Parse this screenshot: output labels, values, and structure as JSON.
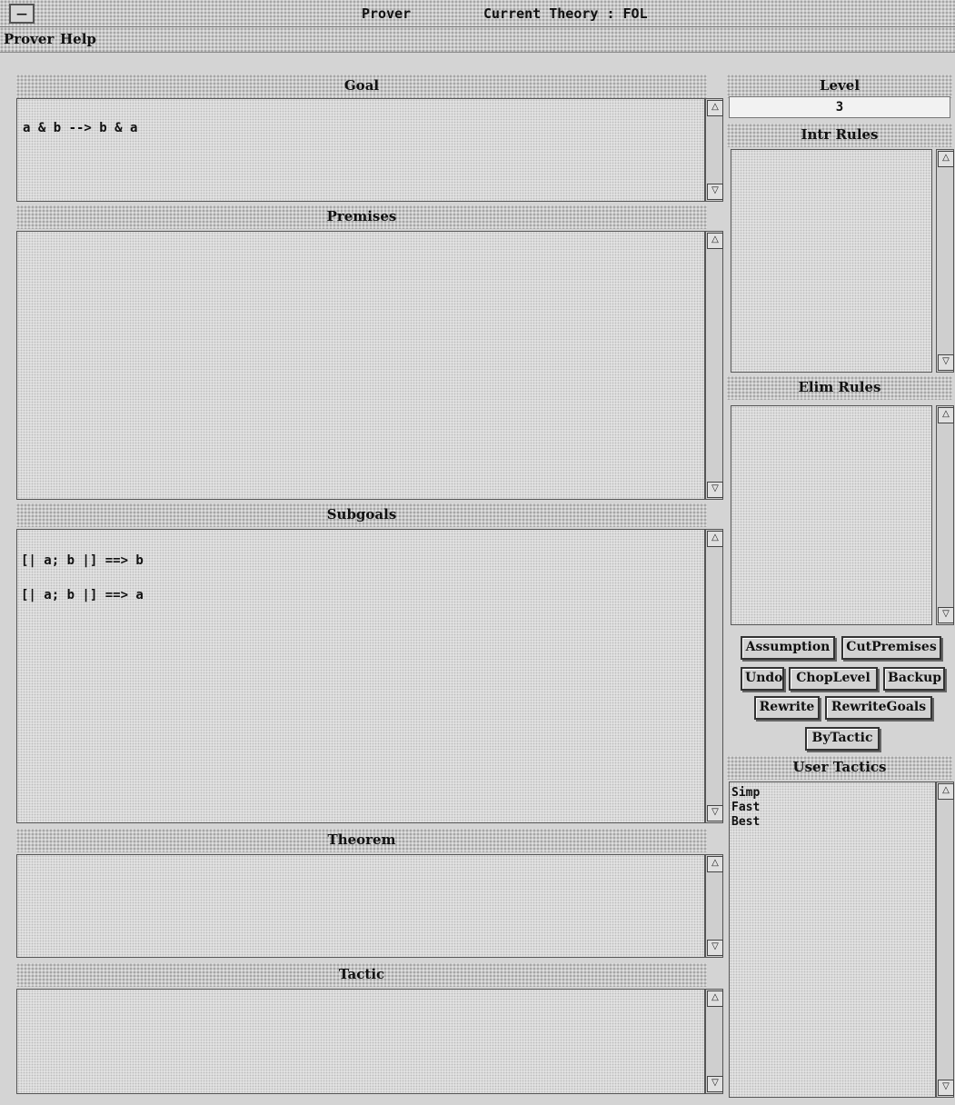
{
  "window": {
    "title": "Prover",
    "current_theory_label": "Current Theory : FOL",
    "system_menu_icon": "minimize-dash-icon"
  },
  "menubar": {
    "items": [
      "Prover",
      "Help"
    ]
  },
  "goal": {
    "header": "Goal",
    "text": "a & b --> b & a"
  },
  "premises": {
    "header": "Premises",
    "lines": []
  },
  "subgoals": {
    "header": "Subgoals",
    "lines": [
      "[| a; b |] ==> b",
      "[| a; b |] ==> a"
    ]
  },
  "theorem": {
    "header": "Theorem",
    "text": ""
  },
  "tactic": {
    "header": "Tactic",
    "text": ""
  },
  "level": {
    "header": "Level",
    "value": "3"
  },
  "intr_rules": {
    "header": "Intr Rules",
    "items": []
  },
  "elim_rules": {
    "header": "Elim Rules",
    "items": []
  },
  "buttons": {
    "assumption": "Assumption",
    "cut_premises": "CutPremises",
    "undo": "Undo",
    "chop_level": "ChopLevel",
    "backup": "Backup",
    "rewrite": "Rewrite",
    "rewrite_goals": "RewriteGoals",
    "by_tactic": "ByTactic"
  },
  "user_tactics": {
    "header": "User Tactics",
    "items": [
      "Simp",
      "Fast",
      "Best"
    ]
  }
}
